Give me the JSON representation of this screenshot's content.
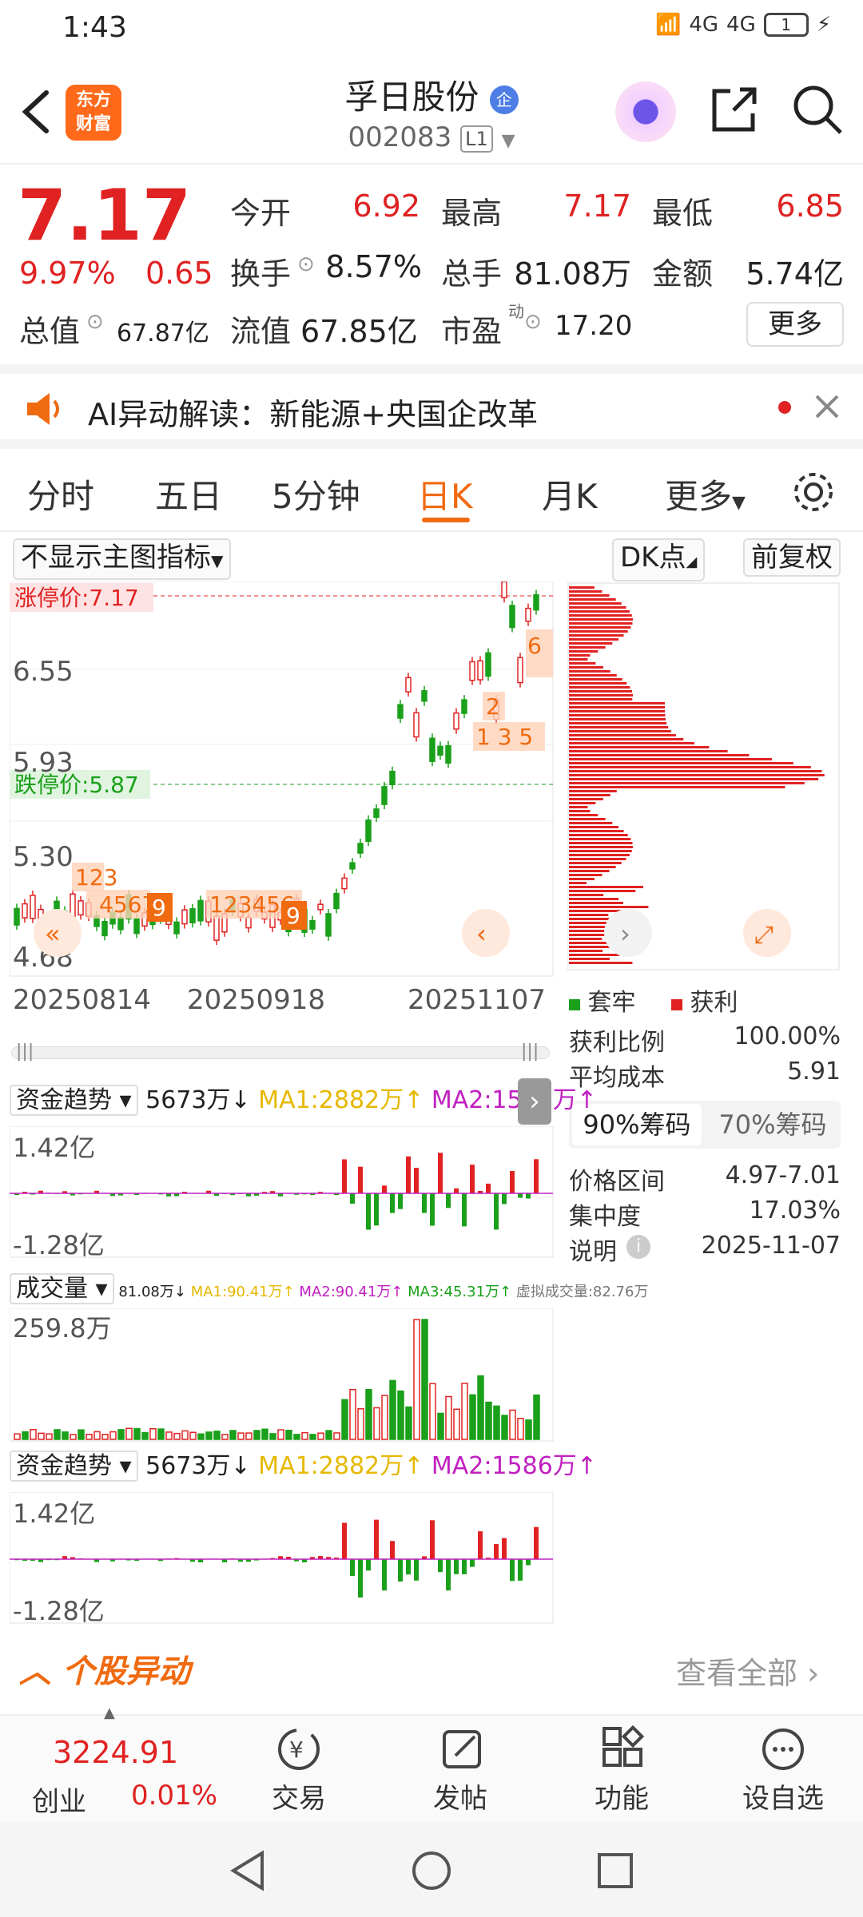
{
  "status_bar": {
    "time": "1:43",
    "net1": "4G",
    "net2": "4G",
    "battery": "1"
  },
  "header": {
    "logo_line1": "东方",
    "logo_line2": "财富",
    "title": "孚日股份",
    "badge": "企",
    "code": "002083",
    "level": "L1"
  },
  "quote": {
    "price": "7.17",
    "change_pct": "9.97%",
    "change": "0.65",
    "open_label": "今开",
    "open": "6.92",
    "high_label": "最高",
    "high": "7.17",
    "low_label": "最低",
    "low": "6.85",
    "turnover_label": "换手",
    "turnover": "8.57%",
    "volume_label": "总手",
    "volume": "81.08万",
    "amount_label": "金额",
    "amount": "5.74亿",
    "mktcap_label": "总值",
    "mktcap": "67.87亿",
    "float_label": "流值",
    "float": "67.85亿",
    "pe_label": "市盈",
    "pe_sup": "动",
    "pe": "17.20",
    "more": "更多"
  },
  "ai_bar": {
    "text": "AI异动解读：新能源+央国企改革"
  },
  "tabs": [
    "分时",
    "五日",
    "5分钟",
    "日K",
    "月K",
    "更多"
  ],
  "chart_controls": {
    "indicator_select": "不显示主图指标",
    "dk": "DK点",
    "adjust": "前复权"
  },
  "main_chart": {
    "limit_up": "涨停价:7.17",
    "limit_down": "跌停价:5.87",
    "y_ticks": [
      "6.55",
      "5.93",
      "5.30",
      "4.68"
    ],
    "x_ticks": [
      "20250814",
      "20250918",
      "20251107"
    ]
  },
  "chips": {
    "legend_trapped": "套牢",
    "legend_profit": "获利",
    "profit_ratio_label": "获利比例",
    "profit_ratio": "100.00%",
    "avg_cost_label": "平均成本",
    "avg_cost": "5.91",
    "tab90": "90%筹码",
    "tab70": "70%筹码",
    "range_label": "价格区间",
    "range": "4.97-7.01",
    "concentration_label": "集中度",
    "concentration": "17.03%",
    "note_label": "说明",
    "date": "2025-11-07"
  },
  "fund_trend": {
    "name": "资金趋势",
    "value": "5673万↓",
    "ma1": "MA1:2882万↑",
    "ma2": "MA2:1586万↑",
    "top": "1.42亿",
    "bottom": "-1.28亿"
  },
  "volume_panel": {
    "name": "成交量",
    "vol": "81.08万↓",
    "ma1": "MA1:90.41万↑",
    "ma2": "MA2:90.41万↑",
    "ma3": "MA3:45.31万↑",
    "virtual": "虚拟成交量:82.76万",
    "top": "259.8万"
  },
  "movement": {
    "title": "个股异动",
    "view_all": "查看全部"
  },
  "bottom_nav": {
    "index_value": "3224.91",
    "index_name": "创业",
    "index_pct": "0.01%",
    "trade": "交易",
    "post": "发帖",
    "functions": "功能",
    "watch": "设自选"
  },
  "colors": {
    "up": "#e02222",
    "down": "#1aa01a",
    "accent": "#f06a10",
    "ma1": "#e6b800",
    "ma2": "#c020c0"
  }
}
